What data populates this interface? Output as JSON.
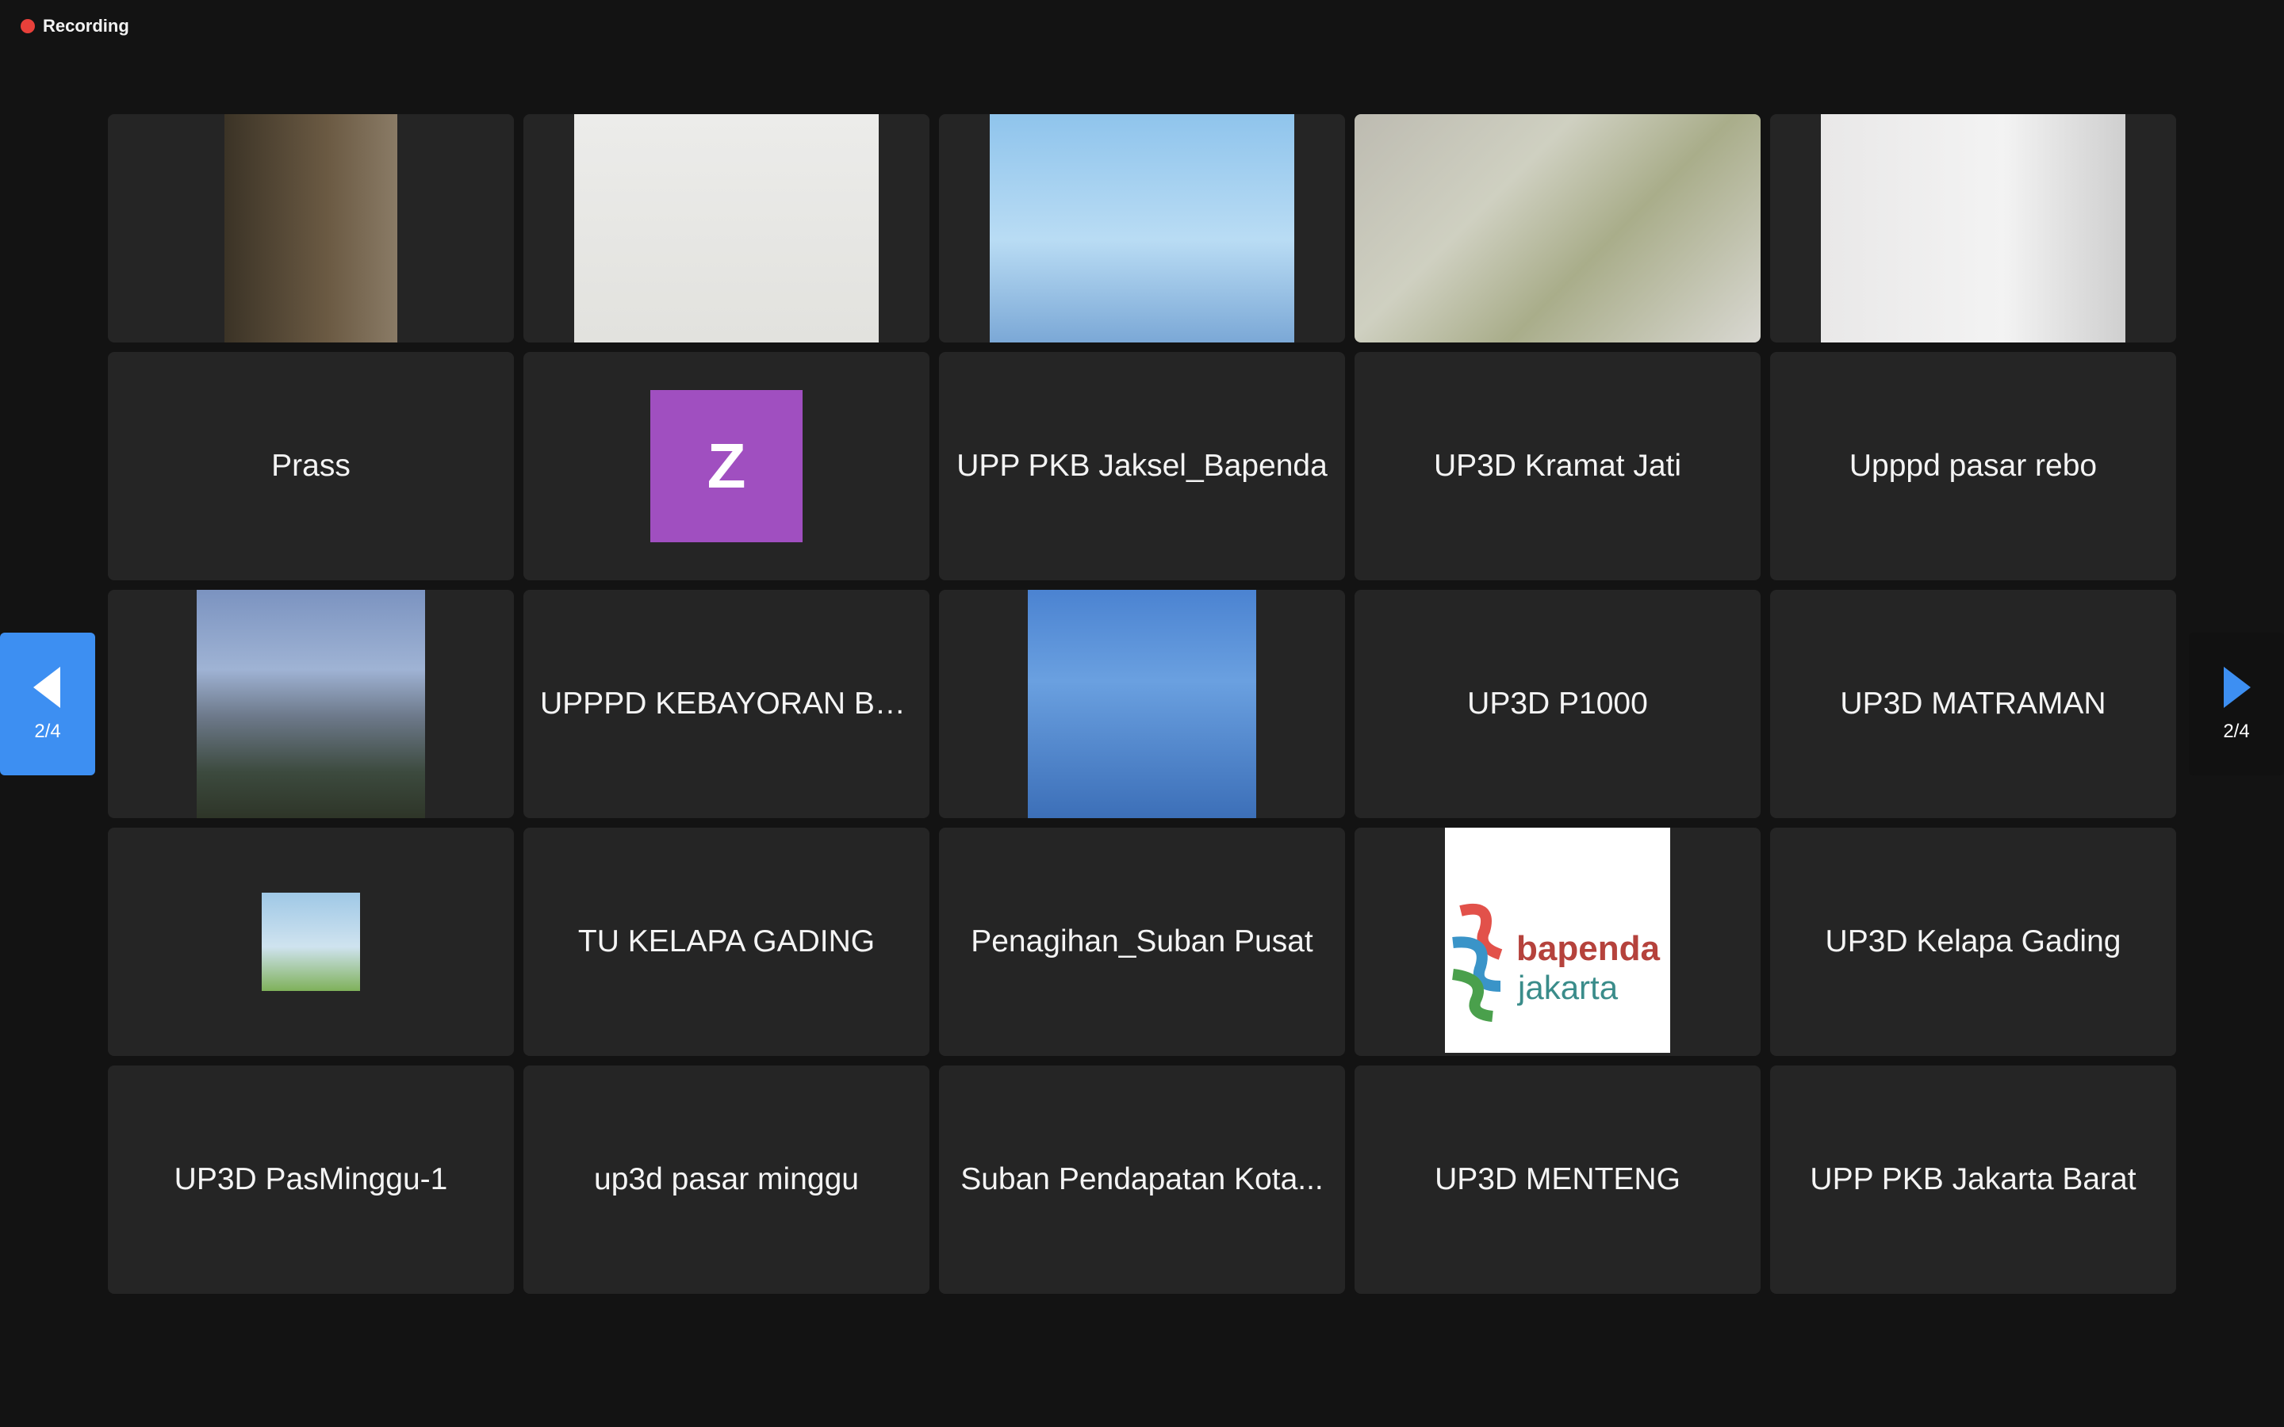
{
  "recording": {
    "label": "Recording"
  },
  "tiles": [
    {
      "kind": "video",
      "name": ""
    },
    {
      "kind": "video",
      "name": ""
    },
    {
      "kind": "video",
      "name": ""
    },
    {
      "kind": "video",
      "name": ""
    },
    {
      "kind": "video",
      "name": ""
    },
    {
      "kind": "name",
      "name": "Prass"
    },
    {
      "kind": "avatar",
      "letter": "Z"
    },
    {
      "kind": "name",
      "name": "UPP PKB Jaksel_Bapenda"
    },
    {
      "kind": "name",
      "name": "UP3D Kramat Jati"
    },
    {
      "kind": "name",
      "name": "Upppd pasar rebo"
    },
    {
      "kind": "photo",
      "name": ""
    },
    {
      "kind": "name",
      "name": "UPPPD KEBAYORAN BA..."
    },
    {
      "kind": "photo",
      "name": ""
    },
    {
      "kind": "name",
      "name": "UP3D P1000"
    },
    {
      "kind": "name",
      "name": "UP3D MATRAMAN"
    },
    {
      "kind": "photo",
      "name": ""
    },
    {
      "kind": "name",
      "name": "TU KELAPA GADING"
    },
    {
      "kind": "name",
      "name": "Penagihan_Suban Pusat"
    },
    {
      "kind": "logo",
      "text1": "bapenda",
      "text2": "jakarta"
    },
    {
      "kind": "name",
      "name": "UP3D Kelapa Gading"
    },
    {
      "kind": "name",
      "name": "UP3D PasMinggu-1"
    },
    {
      "kind": "name",
      "name": "up3d pasar minggu"
    },
    {
      "kind": "name",
      "name": "Suban Pendapatan Kota..."
    },
    {
      "kind": "name",
      "name": "UP3D MENTENG"
    },
    {
      "kind": "name",
      "name": "UPP PKB Jakarta Barat"
    }
  ],
  "pagination": {
    "prev_label": "2/4",
    "next_label": "2/4",
    "prev_color": "#3d8ff2"
  }
}
